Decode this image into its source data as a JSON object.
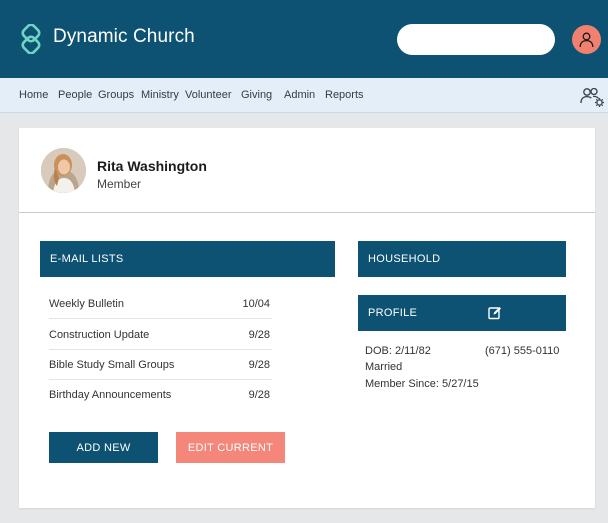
{
  "header": {
    "app_name": "Dynamic Church",
    "search": {
      "value": "",
      "placeholder": ""
    },
    "colors": {
      "brand": "#0d5272",
      "accent": "#f08070"
    },
    "icons": {
      "logo": "ribbon-logo-icon",
      "user": "user-avatar-icon"
    }
  },
  "nav": {
    "items": [
      "Home",
      "People",
      "Groups",
      "Ministry",
      "Volunteer",
      "Giving",
      "Admin",
      "Reports"
    ],
    "settings_icon": "people-settings-icon"
  },
  "member": {
    "name": "Rita Washington",
    "role": "Member"
  },
  "email_lists": {
    "title": "E-MAIL LISTS",
    "rows": [
      {
        "name": "Weekly Bulletin",
        "date": "10/04"
      },
      {
        "name": "Construction Update",
        "date": "9/28"
      },
      {
        "name": "Bible Study Small Groups",
        "date": "9/28"
      },
      {
        "name": "Birthday Announcements",
        "date": "9/28"
      }
    ],
    "add_label": "ADD NEW",
    "edit_label": "EDIT CURRENT"
  },
  "household": {
    "title": "HOUSEHOLD"
  },
  "profile": {
    "title": "PROFILE",
    "dob": "DOB:  2/11/82",
    "phone": "(671) 555-0110",
    "marital_status": "Married",
    "member_since": "Member Since: 5/27/15",
    "edit_icon": "edit-icon"
  }
}
